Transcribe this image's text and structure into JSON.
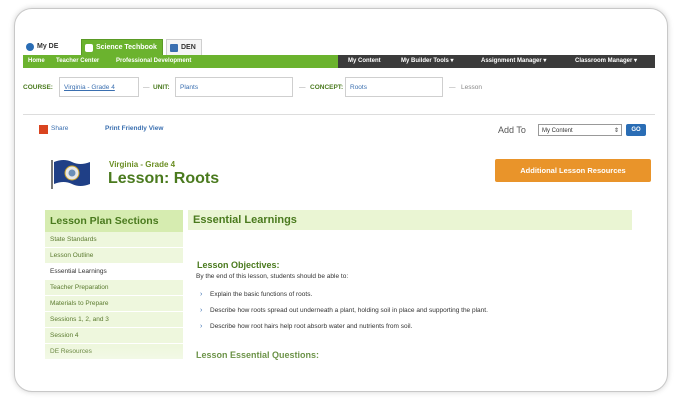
{
  "tabs": [
    {
      "label": "My DE",
      "icon": "globe-icon"
    },
    {
      "label": "Science Techbook",
      "icon": "techbook-icon"
    },
    {
      "label": "DEN",
      "icon": "den-icon"
    }
  ],
  "nav_left": [
    "Home",
    "Teacher Center",
    "Professional Development"
  ],
  "nav_right": [
    "My Content",
    "My Builder Tools ▾",
    "Assignment Manager ▾",
    "Classroom Manager ▾"
  ],
  "course_row": {
    "course_label": "COURSE:",
    "course_value": "Virginia - Grade 4",
    "unit_label": "UNIT:",
    "unit_value": "Plants",
    "concept_label": "CONCEPT:",
    "concept_value": "Roots",
    "lesson_label": "Lesson"
  },
  "toolbar": {
    "share": "Share",
    "print": "Print Friendly View",
    "add_to": "Add To",
    "add_select": "My Content",
    "go": "GO"
  },
  "heading": {
    "grade": "Virginia - Grade 4",
    "title": "Lesson: Roots",
    "resources_button": "Additional Lesson Resources"
  },
  "sidebar": {
    "title": "Lesson Plan Sections",
    "items": [
      "State Standards",
      "Lesson Outline",
      "Essential Learnings",
      "Teacher Preparation",
      "Materials to Prepare",
      "Sessions 1, 2, and 3",
      "Session 4",
      "DE Resources"
    ],
    "active_index": 2
  },
  "main": {
    "section_title": "Essential Learnings",
    "objectives_title": "Lesson Objectives:",
    "objectives_intro": "By the end of this lesson, students should be able to:",
    "objectives": [
      "Explain the basic functions of roots.",
      "Describe how roots spread out underneath a plant, holding soil in place and supporting the plant.",
      "Describe how root hairs help root absorb water and nutrients from soil."
    ],
    "questions_title": "Lesson Essential Questions:"
  },
  "colors": {
    "green": "#6bb32e",
    "dark_green_text": "#4a7a1e",
    "orange": "#e9942a",
    "link_blue": "#3a6fb0"
  }
}
